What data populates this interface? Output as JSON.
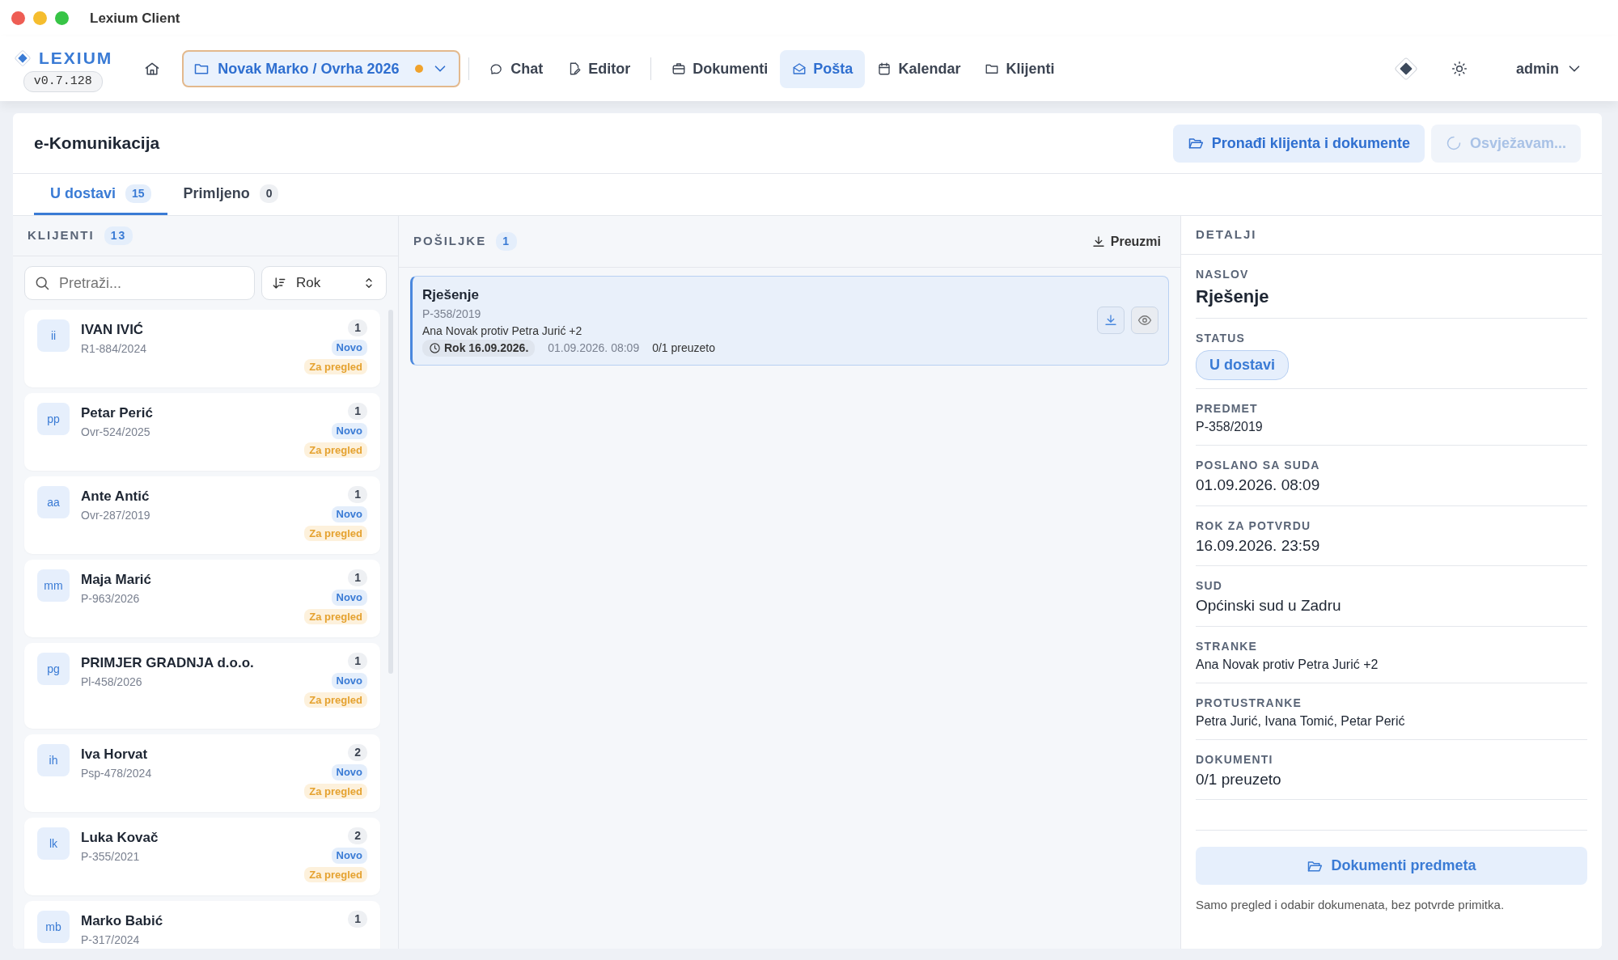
{
  "window": {
    "title": "Lexium Client"
  },
  "brand": {
    "name": "LEXIUM",
    "version": "v0.7.128"
  },
  "project": {
    "label": "Novak Marko / Ovrha 2026",
    "modified": true
  },
  "nav": [
    {
      "label": "Chat",
      "selected": false
    },
    {
      "label": "Editor",
      "selected": false
    },
    {
      "label": "Dokumenti",
      "selected": false
    },
    {
      "label": "Pošta",
      "selected": true
    },
    {
      "label": "Kalendar",
      "selected": false
    },
    {
      "label": "Klijenti",
      "selected": false
    }
  ],
  "user": "admin",
  "page": {
    "title": "e-Komunikacija",
    "find_button": "Pronađi klijenta i dokumente",
    "refresh_button": {
      "label": "Osvježavam...",
      "disabled": true
    }
  },
  "tabs": [
    {
      "label": "U dostavi",
      "count": "15",
      "selected": true
    },
    {
      "label": "Primljeno",
      "count": "0",
      "selected": false
    }
  ],
  "clients": {
    "title": "KLIJENTI",
    "count": "13",
    "search_placeholder": "Pretraži...",
    "sort": "Rok",
    "items": [
      {
        "initials": "ii",
        "name": "IVAN IVIĆ",
        "case": "R1-884/2024",
        "count": "1",
        "badges": [
          {
            "label": "Novo",
            "kind": "new"
          },
          {
            "label": "Za pregled",
            "kind": "review"
          }
        ]
      },
      {
        "initials": "pp",
        "name": "Petar Perić",
        "case": "Ovr-524/2025",
        "count": "1",
        "badges": [
          {
            "label": "Novo",
            "kind": "new"
          },
          {
            "label": "Za pregled",
            "kind": "review"
          }
        ]
      },
      {
        "initials": "aa",
        "name": "Ante Antić",
        "case": "Ovr-287/2019",
        "count": "1",
        "badges": [
          {
            "label": "Novo",
            "kind": "new"
          },
          {
            "label": "Za pregled",
            "kind": "review"
          }
        ]
      },
      {
        "initials": "mm",
        "name": "Maja Marić",
        "case": "P-963/2026",
        "count": "1",
        "badges": [
          {
            "label": "Novo",
            "kind": "new"
          },
          {
            "label": "Za pregled",
            "kind": "review"
          }
        ]
      },
      {
        "initials": "pg",
        "name": "PRIMJER GRADNJA d.o.o.",
        "case": "Pl-458/2026",
        "count": "1",
        "badges": [
          {
            "label": "Novo",
            "kind": "new"
          },
          {
            "label": "Za pregled",
            "kind": "review"
          }
        ]
      },
      {
        "initials": "ih",
        "name": "Iva Horvat",
        "case": "Psp-478/2024",
        "count": "2",
        "badges": [
          {
            "label": "Novo",
            "kind": "new"
          },
          {
            "label": "Za pregled",
            "kind": "review"
          }
        ]
      },
      {
        "initials": "lk",
        "name": "Luka Kovač",
        "case": "P-355/2021",
        "count": "2",
        "badges": [
          {
            "label": "Novo",
            "kind": "new"
          },
          {
            "label": "Za pregled",
            "kind": "review"
          }
        ]
      },
      {
        "initials": "mb",
        "name": "Marko Babić",
        "case": "P-317/2024",
        "count": "1"
      }
    ]
  },
  "shipments": {
    "title": "POŠILJKE",
    "count": "1",
    "download_button": "Preuzmi",
    "items": [
      {
        "title": "Rješenje",
        "case": "P-358/2019",
        "parties": "Ana Novak protiv Petra Jurić +2",
        "deadline": "Rok 16.09.2026.",
        "sent": "01.09.2026. 08:09",
        "downloaded": "0/1 preuzeto",
        "selected": true
      }
    ]
  },
  "details": {
    "title": "DETALJI",
    "fields": [
      {
        "label": "NASLOV",
        "value": "Rješenje",
        "kind": "title"
      },
      {
        "label": "STATUS",
        "value": "U dostavi",
        "kind": "status"
      },
      {
        "label": "PREDMET",
        "value": "P-358/2019",
        "kind": "small"
      },
      {
        "label": "POSLANO SA SUDA",
        "value": "01.09.2026. 08:09",
        "kind": "large"
      },
      {
        "label": "ROK ZA POTVRDU",
        "value": "16.09.2026. 23:59",
        "kind": "large"
      },
      {
        "label": "SUD",
        "value": "Općinski sud u Zadru",
        "kind": "large"
      },
      {
        "label": "STRANKE",
        "value": "Ana Novak protiv Petra Jurić +2",
        "kind": "small"
      },
      {
        "label": "PROTUSTRANKE",
        "value": "Petra Jurić, Ivana Tomić, Petar Perić",
        "kind": "small"
      },
      {
        "label": "DOKUMENTI",
        "value": "0/1 preuzeto",
        "kind": "large"
      }
    ],
    "button": "Dokumenti predmeta",
    "note": "Samo pregled i odabir dokumenata, bez potvrde primitka."
  }
}
